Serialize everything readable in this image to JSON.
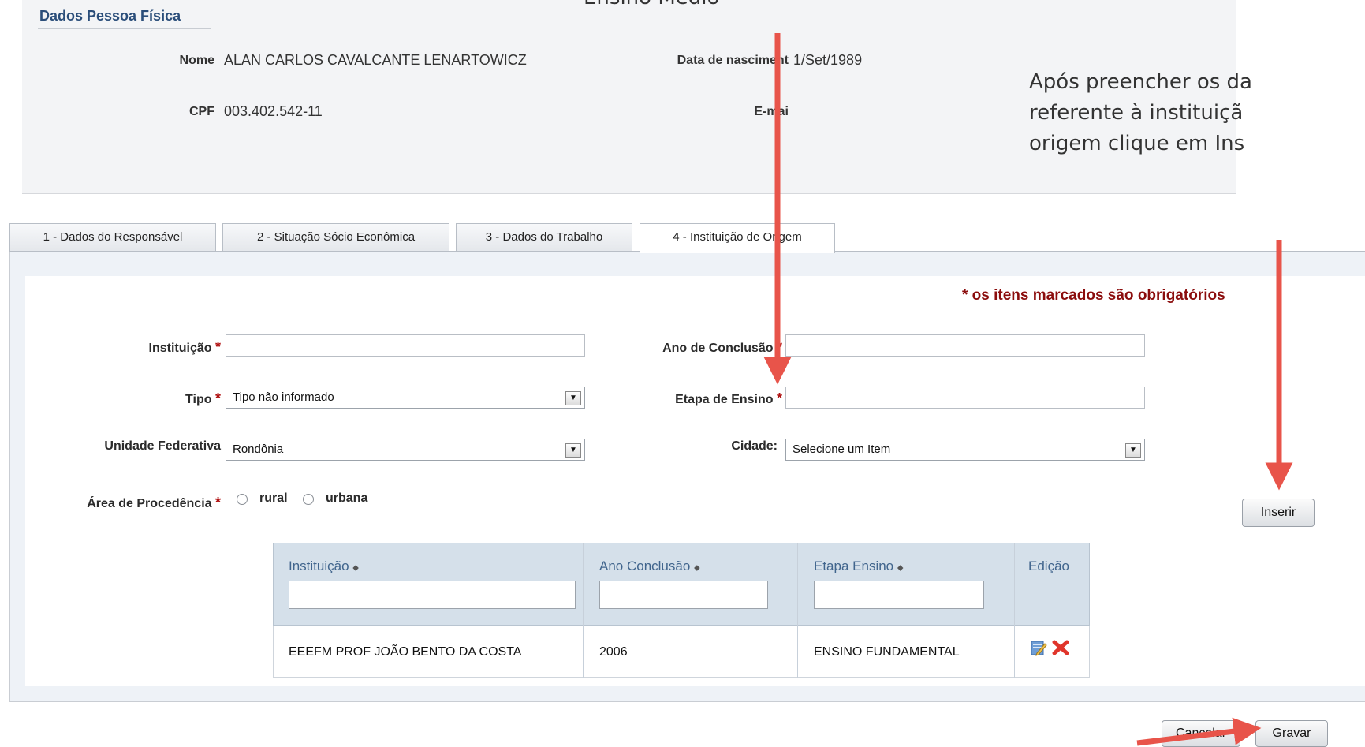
{
  "person": {
    "title": "Dados Pessoa Física",
    "name_label": "Nome",
    "name_value": "ALAN CARLOS CAVALCANTE LENARTOWICZ",
    "birth_label": "Data de nasciment",
    "birth_value": "1/Set/1989",
    "cpf_label": "CPF",
    "cpf_value": "003.402.542-11",
    "email_label": "E-mai"
  },
  "overlay": {
    "top_caption": "Ensino Médio",
    "side_line1": "Após preencher os da",
    "side_line2": "referente à instituiçã",
    "side_line3": "origem clique em Ins",
    "arrow_color": "#e8544a"
  },
  "tabs": [
    {
      "label": "1 - Dados do Responsável"
    },
    {
      "label": "2 - Situação Sócio Econômica"
    },
    {
      "label": "3 - Dados do Trabalho"
    },
    {
      "label": "4 - Instituição de Origem",
      "active": true
    }
  ],
  "form": {
    "required_note": "* os itens marcados são obrigatórios",
    "required_star": "*",
    "instituicao_label": "Instituição",
    "instituicao_value": "",
    "ano_conclusao_label": "Ano de Conclusão",
    "ano_conclusao_value": "",
    "tipo_label": "Tipo",
    "tipo_value": "Tipo não informado",
    "etapa_label": "Etapa de Ensino",
    "etapa_value": "",
    "uf_label": "Unidade Federativa",
    "uf_value": "Rondônia",
    "cidade_label": "Cidade:",
    "cidade_value": "Selecione um Item",
    "area_label": "Área de Procedência",
    "area_options": [
      "rural",
      "urbana"
    ],
    "inserir_label": "Inserir"
  },
  "table": {
    "columns": [
      "Instituição",
      "Ano Conclusão",
      "Etapa Ensino",
      "Edição"
    ],
    "sort_glyph": "⬥",
    "rows": [
      {
        "instituicao": "EEEFM PROF JOÃO BENTO DA COSTA",
        "ano": "2006",
        "etapa": "ENSINO FUNDAMENTAL"
      }
    ],
    "delete_color": "#e0352b"
  },
  "footer": {
    "cancel_label": "Cancelar",
    "save_label": "Gravar"
  }
}
